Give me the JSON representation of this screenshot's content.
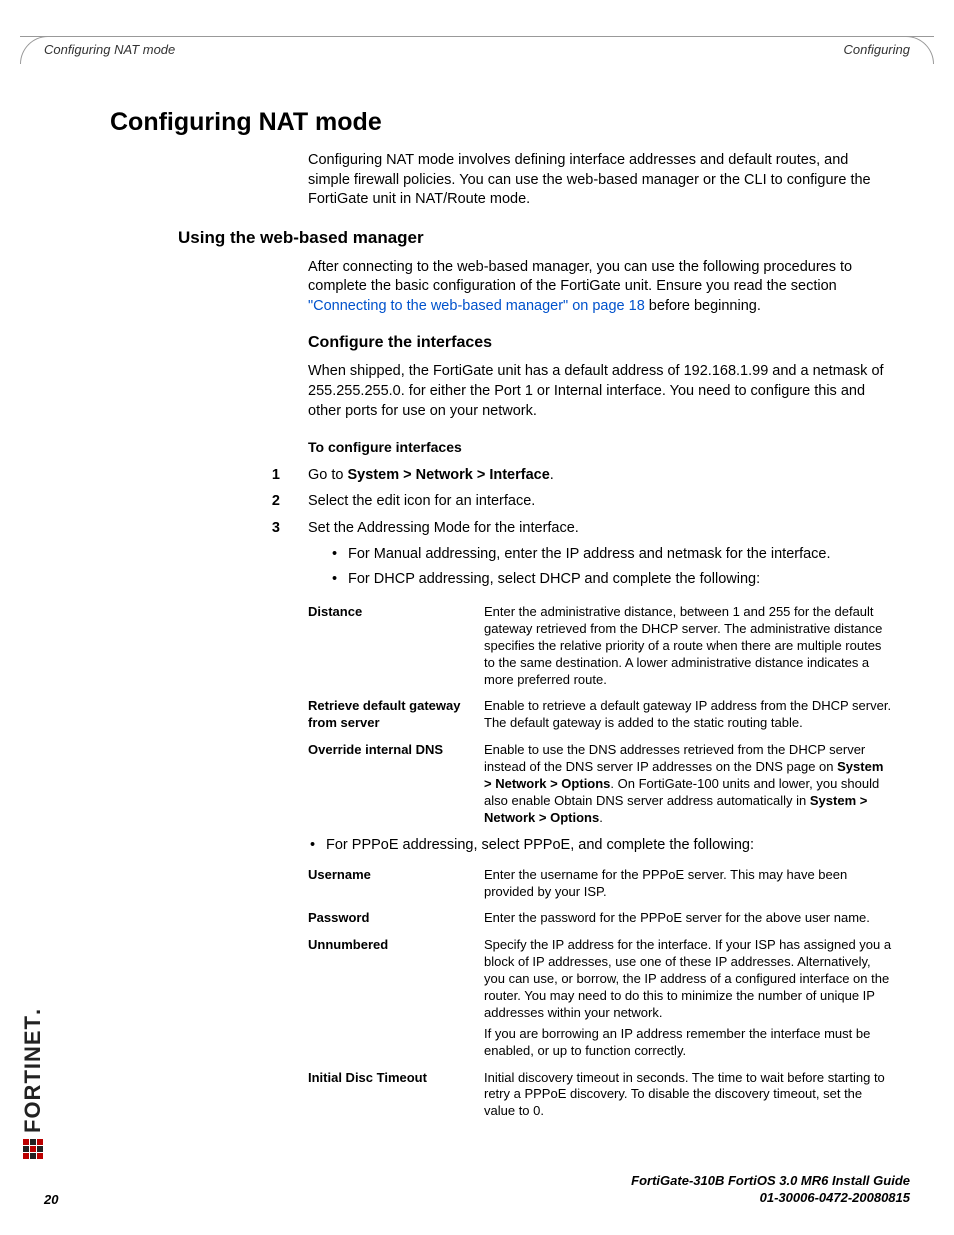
{
  "header": {
    "left": "Configuring NAT mode",
    "right": "Configuring"
  },
  "h1": "Configuring NAT mode",
  "intro": "Configuring NAT mode involves defining interface addresses and default routes, and simple firewall policies. You can use the web-based manager or the CLI to configure the FortiGate unit in NAT/Route mode.",
  "h2a": "Using the web-based manager",
  "p_web_a": "After connecting to the web-based manager, you can use the following procedures to complete the basic configuration of the FortiGate unit. Ensure you read the section ",
  "p_web_link": "\"Connecting to the web-based manager\" on page 18",
  "p_web_b": " before beginning.",
  "h3a": "Configure the interfaces",
  "p_conf": "When shipped, the FortiGate unit has a default address of 192.168.1.99 and a netmask of 255.255.255.0. for either the Port 1 or Internal interface. You need to configure this and other ports for use on your network.",
  "proc_title": "To configure interfaces",
  "steps": {
    "s1_pre": "Go to ",
    "s1_bold": "System > Network > Interface",
    "s1_post": ".",
    "s2": "Select the edit icon for an interface.",
    "s3": "Set the Addressing Mode for the interface."
  },
  "sub": [
    "For Manual addressing, enter the IP address and netmask for the interface.",
    "For DHCP addressing, select DHCP and complete the following:"
  ],
  "dhcp": {
    "r1l": "Distance",
    "r1d": "Enter the administrative distance, between 1 and 255 for the default gateway retrieved from the DHCP server. The administrative distance specifies the relative priority of a route when there are multiple routes to the same destination. A lower administrative distance indicates a more preferred route.",
    "r2l": "Retrieve default gateway from server",
    "r2d": "Enable to retrieve a default gateway IP address from the DHCP server. The default gateway is added to the static routing table.",
    "r3l": "Override internal DNS",
    "r3d_a": "Enable to use the DNS addresses retrieved from the DHCP server instead of the DNS server IP addresses on the DNS page on ",
    "r3d_b1": "System > Network > Options",
    "r3d_c": ". On FortiGate-100 units and lower, you should also enable Obtain DNS server address automatically in ",
    "r3d_b2": "System > Network > Options",
    "r3d_d": "."
  },
  "mid_bullet": "For PPPoE addressing, select PPPoE, and complete the following:",
  "pppoe": {
    "r1l": "Username",
    "r1d": "Enter the username for the PPPoE server. This may have been provided by your ISP.",
    "r2l": "Password",
    "r2d": "Enter the password for the PPPoE server for the above user name.",
    "r3l": "Unnumbered",
    "r3d": "Specify the IP address for the interface. If your ISP has assigned you a block of IP addresses, use one of these IP addresses. Alternatively, you can use, or borrow, the IP address of a configured interface on the router. You may need to do this to minimize the number of unique IP addresses within your network.",
    "r3d2": "If you are borrowing an IP address remember the interface must be enabled, or up to function correctly.",
    "r4l": "Initial Disc Timeout",
    "r4d": "Initial discovery timeout in seconds. The time to wait before starting to retry a PPPoE discovery. To disable the discovery timeout, set the value to 0."
  },
  "footer": {
    "line1": "FortiGate-310B FortiOS 3.0 MR6 Install Guide",
    "line2": "01-30006-0472-20080815",
    "page": "20"
  },
  "logo_text": "FORTINET"
}
